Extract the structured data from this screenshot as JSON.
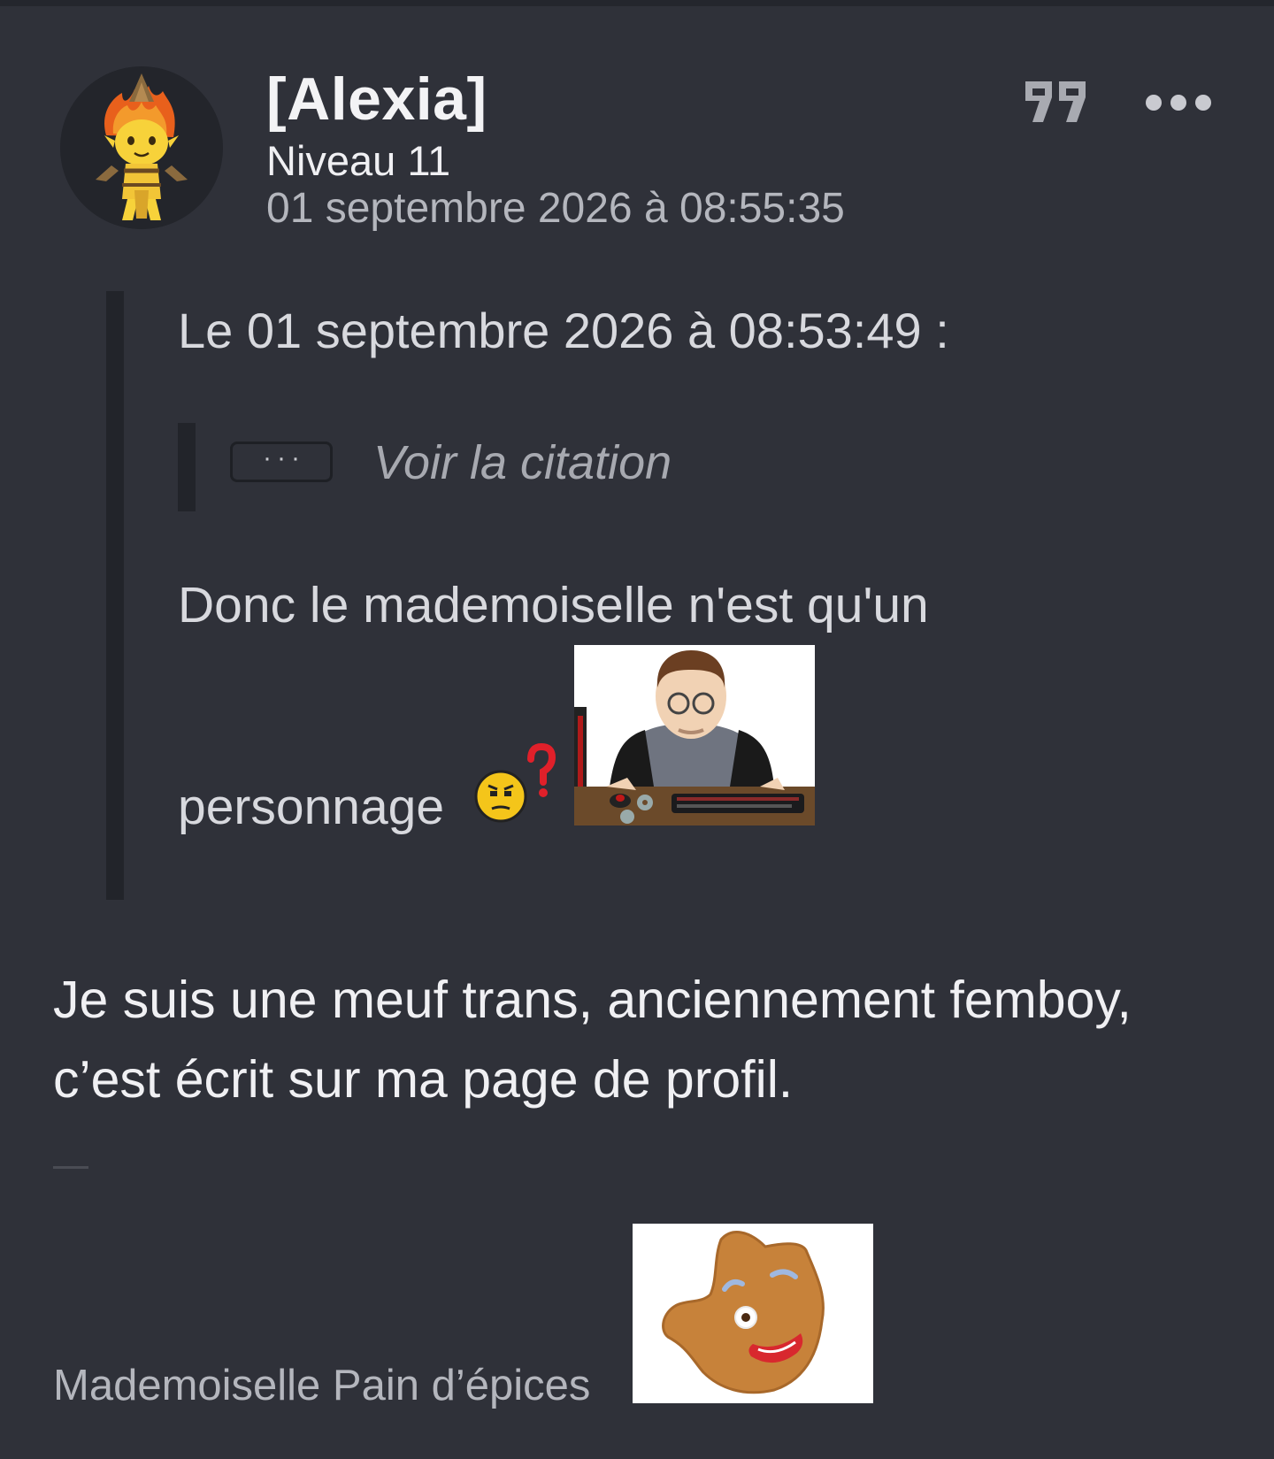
{
  "post": {
    "author": "[Alexia]",
    "level": "Niveau 11",
    "date": "01 septembre 2026 à 08:55:35",
    "actions": {
      "quote_icon": "quote-icon",
      "more_icon": "more-options-icon"
    }
  },
  "quote": {
    "header": "Le 01 septembre 2026 à 08:53:49 :",
    "nested": {
      "pill_label": "···",
      "link_label": "Voir la citation"
    },
    "line1": "Donc le mademoiselle n'est qu'un",
    "line2": "personnage",
    "smiley_icon": "thinking-question-smiley-icon",
    "sticker_icon": "computer-guy-sticker"
  },
  "reply": {
    "text": "Je suis une meuf trans, anciennement femboy, c’est écrit sur ma page de profil."
  },
  "signature": {
    "text": "Mademoiselle Pain d’épices",
    "sticker_icon": "gingerbread-sticker"
  },
  "colors": {
    "background": "#2f3139",
    "quote_bar": "#22242a",
    "text_primary": "#f0f0f3",
    "text_secondary": "#b4b6bd"
  }
}
